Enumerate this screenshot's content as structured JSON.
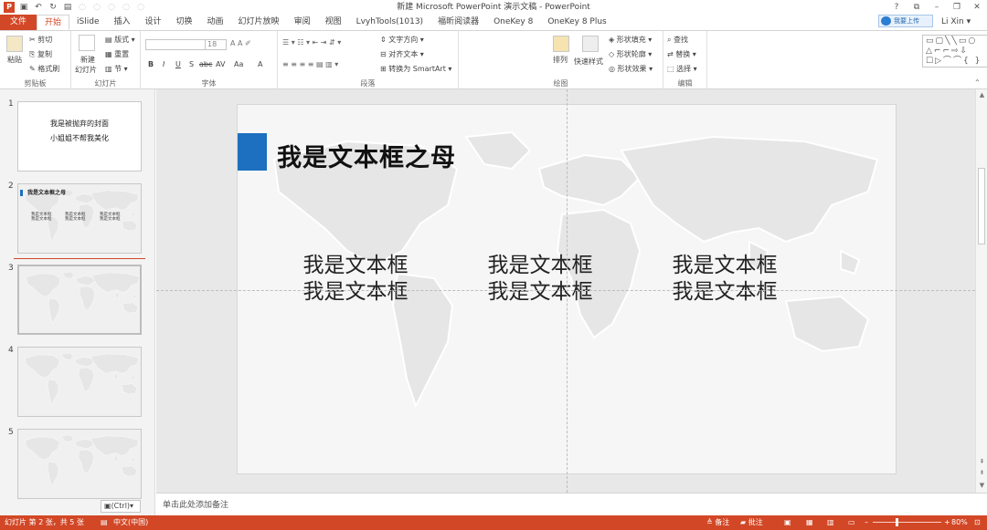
{
  "window": {
    "title": "新建 Microsoft PowerPoint 演示文稿 - PowerPoint",
    "controls": [
      "?",
      "⧉",
      "–",
      "❐",
      "✕"
    ]
  },
  "qat_icons": [
    "powerpoint-logo-icon",
    "save-icon",
    "undo-icon",
    "redo-icon",
    "start-from-beginning-icon"
  ],
  "tabs": [
    {
      "label": "文件"
    },
    {
      "label": "开始"
    },
    {
      "label": "iSlide"
    },
    {
      "label": "插入"
    },
    {
      "label": "设计"
    },
    {
      "label": "切换"
    },
    {
      "label": "动画"
    },
    {
      "label": "幻灯片放映"
    },
    {
      "label": "审阅"
    },
    {
      "label": "视图"
    },
    {
      "label": "LvyhTools(1013)"
    },
    {
      "label": "福昕阅读器"
    },
    {
      "label": "OneKey 8"
    },
    {
      "label": "OneKey 8 Plus"
    }
  ],
  "cloud_button": "我要上传",
  "user": "Li Xin",
  "ribbon": {
    "clipboard": {
      "paste": "粘贴",
      "cut": "剪切",
      "copy": "复制",
      "format_painter": "格式刷",
      "label": "剪贴板"
    },
    "slides": {
      "new_slide": "新建",
      "new_slide2": "幻灯片",
      "layout": "版式",
      "reset": "重置",
      "section": "节",
      "label": "幻灯片"
    },
    "font": {
      "size": "18",
      "label": "字体",
      "buttons": [
        "B",
        "I",
        "U",
        "S",
        "abc",
        "AV",
        "Aa",
        "A"
      ]
    },
    "paragraph": {
      "text_direction": "文字方向",
      "align_text": "对齐文本",
      "smartart": "转换为 SmartArt",
      "label": "段落"
    },
    "drawing": {
      "arrange": "排列",
      "quick_styles": "快速样式",
      "shape_fill": "形状填充",
      "shape_outline": "形状轮廓",
      "shape_effects": "形状效果",
      "label": "绘图"
    },
    "editing": {
      "find": "查找",
      "replace": "替换",
      "select": "选择",
      "label": "编辑"
    }
  },
  "thumbnails": [
    {
      "number": "1",
      "line1": "我是被抛弃的封面",
      "line2": "小姐姐不帮我美化"
    },
    {
      "number": "2",
      "title": "我是文本框之母",
      "cols": [
        "我是文本框\n我是文本框",
        "我是文本框\n我是文本框",
        "我是文本框\n我是文本框"
      ]
    },
    {
      "number": "3"
    },
    {
      "number": "4"
    },
    {
      "number": "5"
    }
  ],
  "paste_options": "(Ctrl)",
  "slide": {
    "title": "我是文本框之母",
    "boxes": [
      {
        "line1": "我是文本框",
        "line2": "我是文本框"
      },
      {
        "line1": "我是文本框",
        "line2": "我是文本框"
      },
      {
        "line1": "我是文本框",
        "line2": "我是文本框"
      }
    ]
  },
  "notes_placeholder": "单击此处添加备注",
  "status": {
    "slide_info": "幻灯片 第 2 张，共 5 张",
    "language": "中文(中国)",
    "notes": "备注",
    "comments": "批注",
    "zoom": "80%"
  },
  "colors": {
    "accent": "#d24726",
    "title_bar": "#1d6fbf"
  }
}
